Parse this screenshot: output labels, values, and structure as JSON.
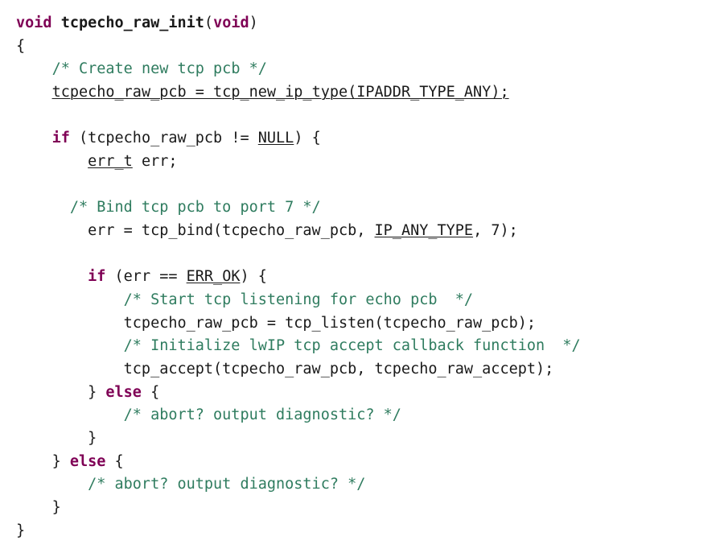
{
  "code": {
    "l01_kw_void": "void",
    "l01_fn": "tcpecho_raw_init",
    "l01_kw_void2": "void",
    "l02_brace": "{",
    "l03_cm": "/* Create new tcp pcb */",
    "l04_txt": "tcpecho_raw_pcb = tcp_new_ip_type(IPADDR_TYPE_ANY);",
    "l06_kw_if": "if",
    "l06_a": " (tcpecho_raw_pcb != ",
    "l06_null": "NULL",
    "l06_b": ") {",
    "l07_errt": "err_t",
    "l07_b": " err;",
    "l09_cm": "/* Bind tcp pcb to port 7 */",
    "l10_a": "err = tcp_bind(tcpecho_raw_pcb, ",
    "l10_ip": "IP_ANY_TYPE",
    "l10_b": ", 7);",
    "l12_kw_if": "if",
    "l12_a": " (err == ",
    "l12_errok": "ERR_OK",
    "l12_b": ") {",
    "l13_cm": "/* Start tcp listening for echo pcb  */",
    "l14_txt": "tcpecho_raw_pcb = tcp_listen(tcpecho_raw_pcb);",
    "l15_cm": "/* Initialize lwIP tcp accept callback function  */",
    "l16_txt": "tcp_accept(tcpecho_raw_pcb, tcpecho_raw_accept);",
    "l17_a": "} ",
    "l17_kw_else": "else",
    "l17_b": " {",
    "l18_cm": "/* abort? output diagnostic? */",
    "l19_brace": "}",
    "l20_a": "} ",
    "l20_kw_else": "else",
    "l20_b": " {",
    "l21_cm": "/* abort? output diagnostic? */",
    "l22_brace": "}",
    "l23_brace": "}"
  }
}
